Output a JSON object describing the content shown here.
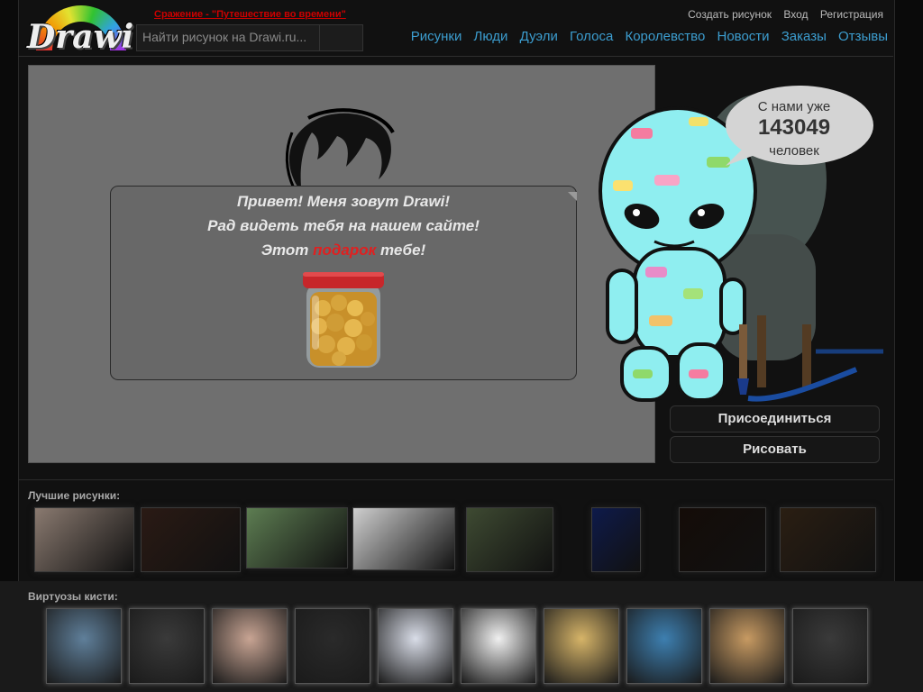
{
  "header": {
    "logo_text": "Drawi",
    "promo_link": "Сражение - \"Путешествие во времени\"",
    "search_placeholder": "Найти рисунок на Drawi.ru...",
    "top_links": [
      "Создать рисунок",
      "Вход",
      "Регистрация"
    ],
    "nav": [
      "Рисунки",
      "Люди",
      "Дуэли",
      "Голоса",
      "Королевство",
      "Новости",
      "Заказы",
      "Отзывы"
    ]
  },
  "welcome": {
    "line1": "Привет! Меня зовут Drawi!",
    "line2": "Рад видеть тебя на нашем сайте!",
    "line3_before": "Этот ",
    "line3_gift": "подарок",
    "line3_after": " тебе!"
  },
  "counter": {
    "prefix": "С нами уже",
    "count": "143049",
    "suffix": "человек"
  },
  "actions": {
    "join": "Присоединиться",
    "draw": "Рисовать"
  },
  "best": {
    "title": "Лучшие рисунки:",
    "items": [
      {
        "name": "paper-sketches",
        "bg": "#8a7a70"
      },
      {
        "name": "spiderman-portrait",
        "bg": "#2a1a14"
      },
      {
        "name": "gazebo-park",
        "bg": "#5d7d52"
      },
      {
        "name": "girl-pencil-sketch",
        "bg": "#cfcfcf"
      },
      {
        "name": "forest-scene",
        "bg": "#3e4a32"
      },
      {
        "name": "night-moon",
        "bg": "#0e1a4a"
      },
      {
        "name": "fox",
        "bg": "#140c08"
      },
      {
        "name": "night-city",
        "bg": "#2a1e12"
      }
    ]
  },
  "virtuosos": {
    "title": "Виртуозы кисти:",
    "items": [
      {
        "name": "man-in-hat",
        "bg": "#5f7f9a"
      },
      {
        "name": "anime-guy",
        "bg": "#3a3a3a"
      },
      {
        "name": "girl-with-dog",
        "bg": "#c8a493"
      },
      {
        "name": "bw-girl",
        "bg": "#2a2a2a"
      },
      {
        "name": "cosplay-girls",
        "bg": "#d9dde8"
      },
      {
        "name": "cartoon-sketch",
        "bg": "#f0f0f0"
      },
      {
        "name": "blonde-girl",
        "bg": "#d6b468"
      },
      {
        "name": "seaside-man",
        "bg": "#3d7fb0"
      },
      {
        "name": "flower-girl",
        "bg": "#c79a62"
      },
      {
        "name": "bw-blonde",
        "bg": "#3a3a3a"
      }
    ]
  },
  "colors": {
    "accent_link": "#3c9dcf",
    "promo_red": "#cc0000",
    "gift_red": "#e02020"
  }
}
